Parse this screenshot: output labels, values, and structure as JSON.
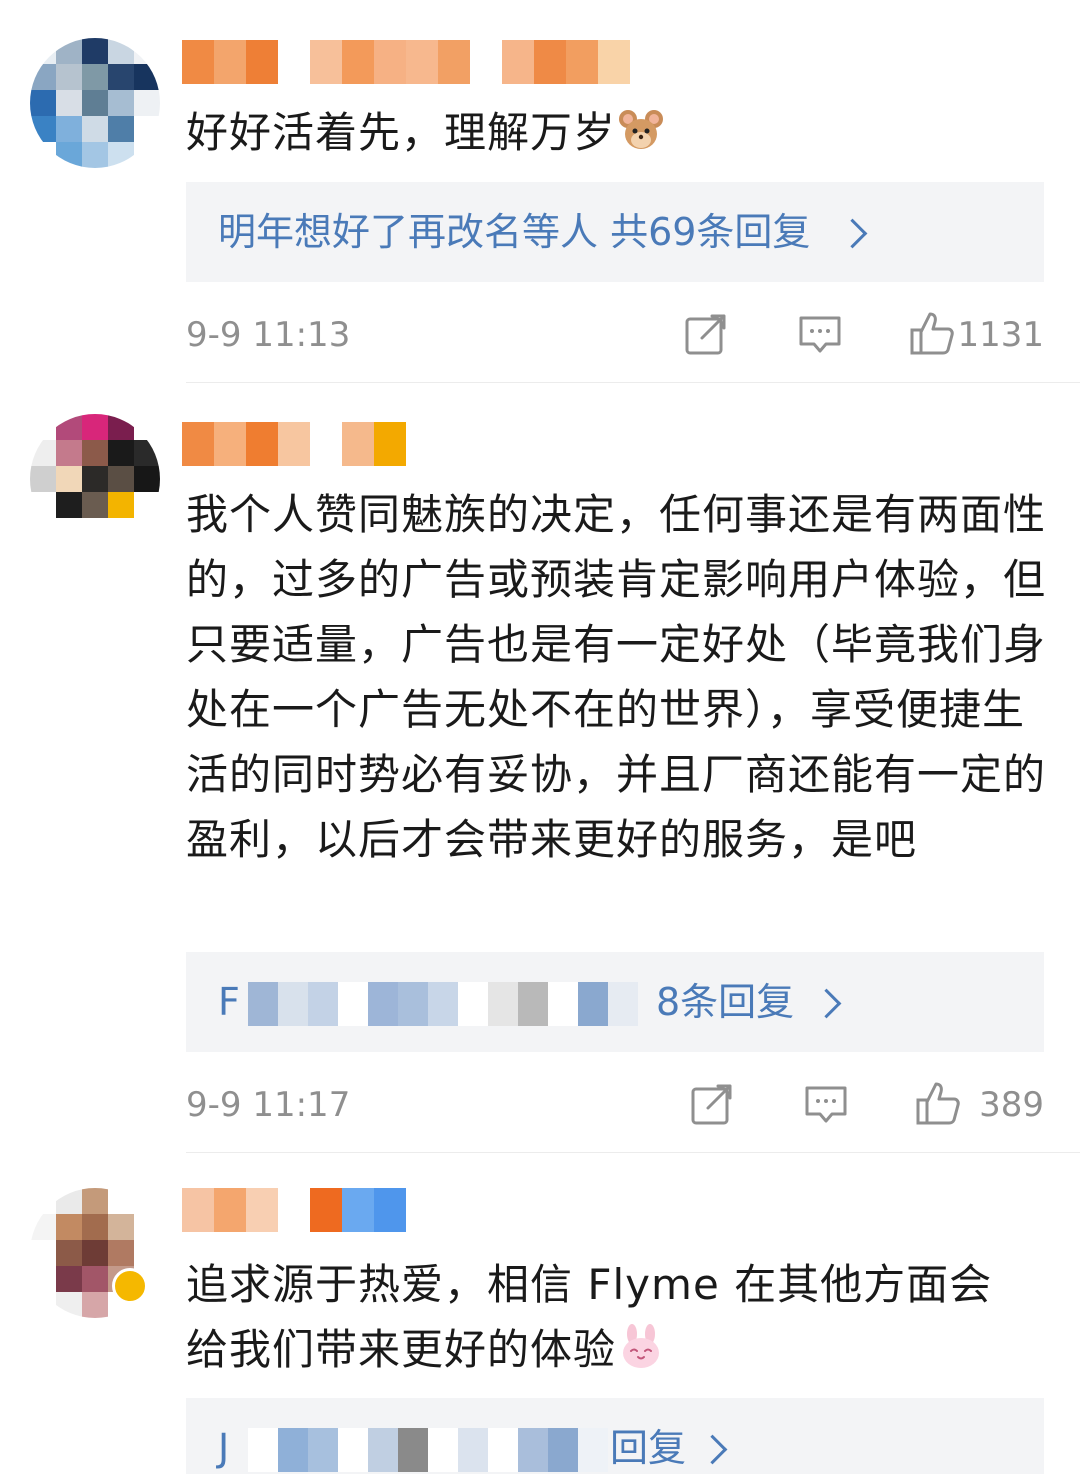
{
  "comments": [
    {
      "text": "好好活着先，理解万岁",
      "emoji": "jerry-mouse-emoji",
      "reply_summary": "明年想好了再改名等人  共69条回复",
      "timestamp": "9-9 11:13",
      "likes": "1131"
    },
    {
      "text": "我个人赞同魅族的决定，任何事还是有两面性的，过多的广告或预装肯定影响用户体验，但只要适量，广告也是有一定好处（毕竟我们身处在一个广告无处不在的世界），享受便捷生活的同时势必有妥协，并且厂商还能有一定的盈利，以后才会带来更好的服务，是吧",
      "reply_summary_prefix": "F",
      "reply_summary_suffix": "8条回复",
      "timestamp": "9-9 11:17",
      "likes": "389"
    },
    {
      "text_line1": "追求源于热爱，相信 Flyme 在其他方面会",
      "text_line2": "给我们带来更好的体验",
      "emoji": "pink-bunny-emoji",
      "reply_summary_prefix": "J",
      "reply_summary_suffix": "回复"
    }
  ],
  "icons": {
    "share": "share-icon",
    "comment": "comment-icon",
    "like": "thumbs-up-icon"
  },
  "colors": {
    "link": "#4a7ab8",
    "meta": "#8f8f8f",
    "text": "#1a1a1a",
    "reply_bg": "#f3f4f6",
    "verified_badge": "#f5b800"
  }
}
